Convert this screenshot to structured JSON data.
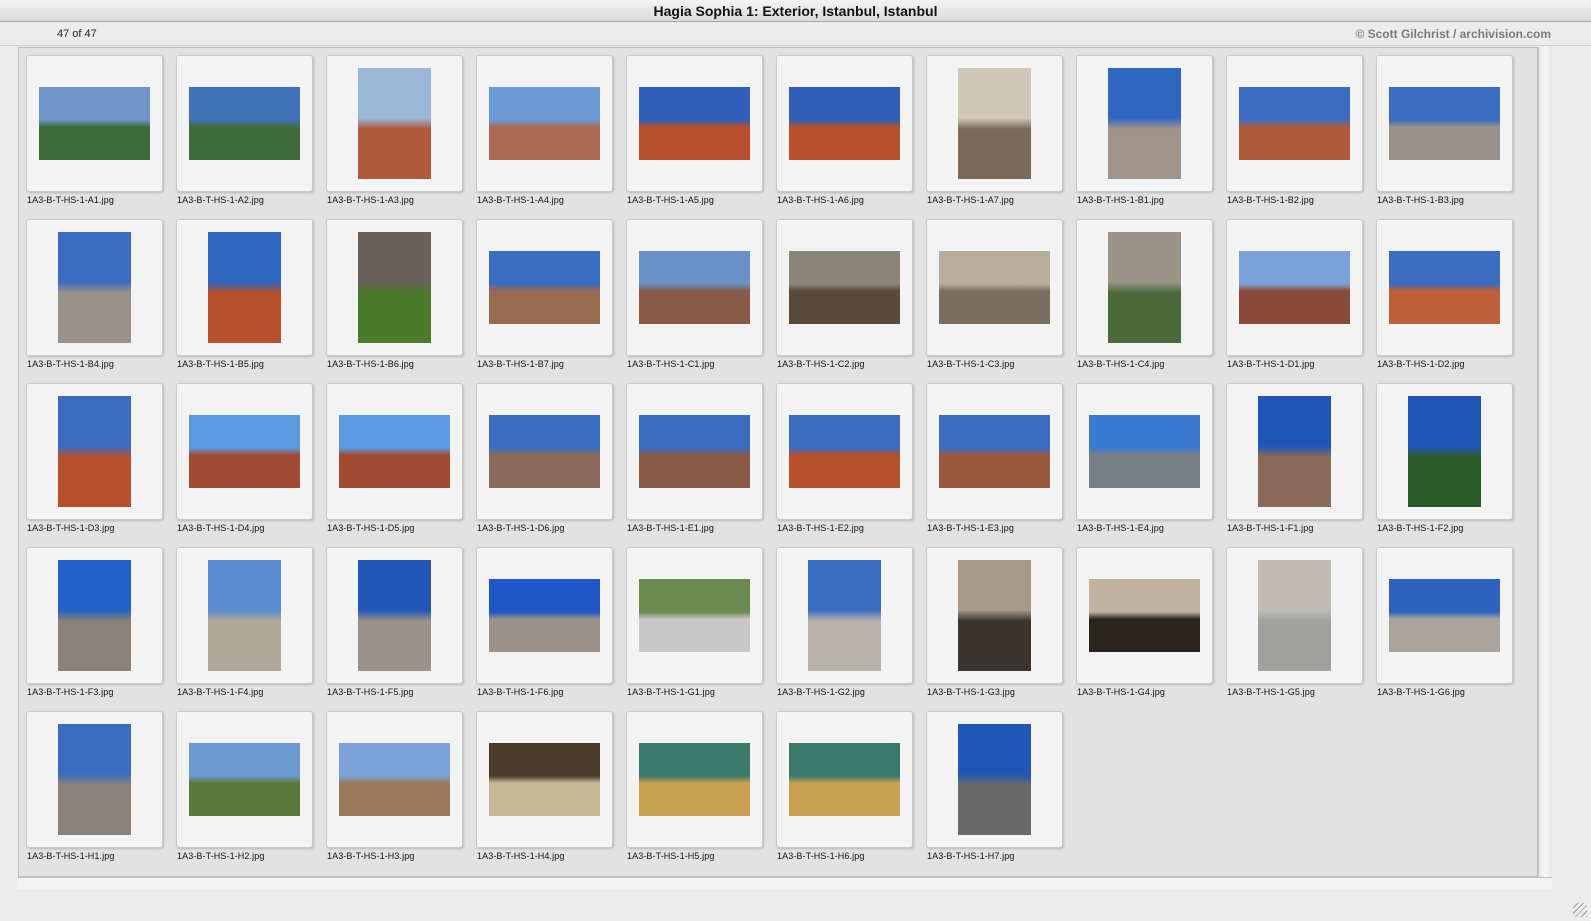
{
  "window": {
    "title": "Hagia Sophia 1: Exterior, Istanbul, Istanbul",
    "count_label": "47 of 47",
    "credit": "© Scott Gilchrist / archivision.com"
  },
  "thumbnails": [
    {
      "file": "1A3-B-T-HS-1-A1.jpg",
      "orient": "landscape",
      "sky": "#6f95c8",
      "subject": "#3f6b3a"
    },
    {
      "file": "1A3-B-T-HS-1-A2.jpg",
      "orient": "landscape",
      "sky": "#3f72b8",
      "subject": "#3f6b3a"
    },
    {
      "file": "1A3-B-T-HS-1-A3.jpg",
      "orient": "portrait",
      "sky": "#9bb7d8",
      "subject": "#b05a3c"
    },
    {
      "file": "1A3-B-T-HS-1-A4.jpg",
      "orient": "landscape",
      "sky": "#6b9bd6",
      "subject": "#a86a52"
    },
    {
      "file": "1A3-B-T-HS-1-A5.jpg",
      "orient": "landscape",
      "sky": "#2f5fb8",
      "subject": "#b8502e"
    },
    {
      "file": "1A3-B-T-HS-1-A6.jpg",
      "orient": "landscape",
      "sky": "#2f5fb8",
      "subject": "#b8502e"
    },
    {
      "file": "1A3-B-T-HS-1-A7.jpg",
      "orient": "portrait",
      "sky": "#cfc8b8",
      "subject": "#7a6a58"
    },
    {
      "file": "1A3-B-T-HS-1-B1.jpg",
      "orient": "portrait",
      "sky": "#2f66c0",
      "subject": "#a0948a"
    },
    {
      "file": "1A3-B-T-HS-1-B2.jpg",
      "orient": "landscape",
      "sky": "#3a6cc0",
      "subject": "#b05a3c"
    },
    {
      "file": "1A3-B-T-HS-1-B3.jpg",
      "orient": "landscape",
      "sky": "#3a6cc0",
      "subject": "#9a928a"
    },
    {
      "file": "1A3-B-T-HS-1-B4.jpg",
      "orient": "portrait",
      "sky": "#3a6cc0",
      "subject": "#9a928a"
    },
    {
      "file": "1A3-B-T-HS-1-B5.jpg",
      "orient": "portrait",
      "sky": "#2f66c0",
      "subject": "#b8502e"
    },
    {
      "file": "1A3-B-T-HS-1-B6.jpg",
      "orient": "portrait",
      "sky": "#6a6258",
      "subject": "#4a7a2a"
    },
    {
      "file": "1A3-B-T-HS-1-B7.jpg",
      "orient": "landscape",
      "sky": "#3a6cc0",
      "subject": "#9a6a50"
    },
    {
      "file": "1A3-B-T-HS-1-C1.jpg",
      "orient": "landscape",
      "sky": "#6a90c8",
      "subject": "#8a5a48"
    },
    {
      "file": "1A3-B-T-HS-1-C2.jpg",
      "orient": "landscape",
      "sky": "#8a8478",
      "subject": "#5a4a38"
    },
    {
      "file": "1A3-B-T-HS-1-C3.jpg",
      "orient": "landscape",
      "sky": "#b8ae9a",
      "subject": "#7a6e5e"
    },
    {
      "file": "1A3-B-T-HS-1-C4.jpg",
      "orient": "portrait",
      "sky": "#9a9488",
      "subject": "#4a6a3a"
    },
    {
      "file": "1A3-B-T-HS-1-D1.jpg",
      "orient": "landscape",
      "sky": "#7aa2d8",
      "subject": "#8a4a3a"
    },
    {
      "file": "1A3-B-T-HS-1-D2.jpg",
      "orient": "landscape",
      "sky": "#3a6cc0",
      "subject": "#c0603a"
    },
    {
      "file": "1A3-B-T-HS-1-D3.jpg",
      "orient": "portrait",
      "sky": "#3a6cc0",
      "subject": "#b8502e"
    },
    {
      "file": "1A3-B-T-HS-1-D4.jpg",
      "orient": "landscape",
      "sky": "#5a9ae0",
      "subject": "#a04a32"
    },
    {
      "file": "1A3-B-T-HS-1-D5.jpg",
      "orient": "landscape",
      "sky": "#5a9ae0",
      "subject": "#a04a32"
    },
    {
      "file": "1A3-B-T-HS-1-D6.jpg",
      "orient": "landscape",
      "sky": "#3a6cc0",
      "subject": "#8a6a5a"
    },
    {
      "file": "1A3-B-T-HS-1-E1.jpg",
      "orient": "landscape",
      "sky": "#3a6cc0",
      "subject": "#8a5a48"
    },
    {
      "file": "1A3-B-T-HS-1-E2.jpg",
      "orient": "landscape",
      "sky": "#3a6cc0",
      "subject": "#b8502e"
    },
    {
      "file": "1A3-B-T-HS-1-E3.jpg",
      "orient": "landscape",
      "sky": "#3a6cc0",
      "subject": "#9a5a40"
    },
    {
      "file": "1A3-B-T-HS-1-E4.jpg",
      "orient": "landscape",
      "sky": "#3a7ad0",
      "subject": "#7a7e88"
    },
    {
      "file": "1A3-B-T-HS-1-F1.jpg",
      "orient": "portrait",
      "sky": "#1f56b8",
      "subject": "#8a6a5a"
    },
    {
      "file": "1A3-B-T-HS-1-F2.jpg",
      "orient": "portrait",
      "sky": "#1f56b8",
      "subject": "#2a5a2a"
    },
    {
      "file": "1A3-B-T-HS-1-F3.jpg",
      "orient": "portrait",
      "sky": "#1f62c8",
      "subject": "#8a8278"
    },
    {
      "file": "1A3-B-T-HS-1-F4.jpg",
      "orient": "portrait",
      "sky": "#5a8ad0",
      "subject": "#b0a898"
    },
    {
      "file": "1A3-B-T-HS-1-F5.jpg",
      "orient": "portrait",
      "sky": "#1f56b8",
      "subject": "#9a9288"
    },
    {
      "file": "1A3-B-T-HS-1-F6.jpg",
      "orient": "landscape",
      "sky": "#1f56c8",
      "subject": "#9a9288"
    },
    {
      "file": "1A3-B-T-HS-1-G1.jpg",
      "orient": "landscape",
      "sky": "#6a8a50",
      "subject": "#c8c8c8"
    },
    {
      "file": "1A3-B-T-HS-1-G2.jpg",
      "orient": "portrait",
      "sky": "#3a6cc0",
      "subject": "#b8b4ac"
    },
    {
      "file": "1A3-B-T-HS-1-G3.jpg",
      "orient": "portrait",
      "sky": "#a89a88",
      "subject": "#3a3430"
    },
    {
      "file": "1A3-B-T-HS-1-G4.jpg",
      "orient": "landscape",
      "sky": "#c0b4a0",
      "subject": "#2a2420"
    },
    {
      "file": "1A3-B-T-HS-1-G5.jpg",
      "orient": "portrait",
      "sky": "#c0bcb4",
      "subject": "#a0a09c"
    },
    {
      "file": "1A3-B-T-HS-1-G6.jpg",
      "orient": "landscape",
      "sky": "#2f62c0",
      "subject": "#a8a49c"
    },
    {
      "file": "1A3-B-T-HS-1-H1.jpg",
      "orient": "portrait",
      "sky": "#3a6cc0",
      "subject": "#8a8278"
    },
    {
      "file": "1A3-B-T-HS-1-H2.jpg",
      "orient": "landscape",
      "sky": "#6a9ad0",
      "subject": "#5a7a3a"
    },
    {
      "file": "1A3-B-T-HS-1-H3.jpg",
      "orient": "landscape",
      "sky": "#7aa2d8",
      "subject": "#9a7a5a"
    },
    {
      "file": "1A3-B-T-HS-1-H4.jpg",
      "orient": "landscape",
      "sky": "#4a3a2a",
      "subject": "#c8b898"
    },
    {
      "file": "1A3-B-T-HS-1-H5.jpg",
      "orient": "landscape",
      "sky": "#3a7a6a",
      "subject": "#c8a050"
    },
    {
      "file": "1A3-B-T-HS-1-H6.jpg",
      "orient": "landscape",
      "sky": "#3a7a6a",
      "subject": "#c8a050"
    },
    {
      "file": "1A3-B-T-HS-1-H7.jpg",
      "orient": "portrait",
      "sky": "#1f56b8",
      "subject": "#6a6a6a"
    }
  ]
}
